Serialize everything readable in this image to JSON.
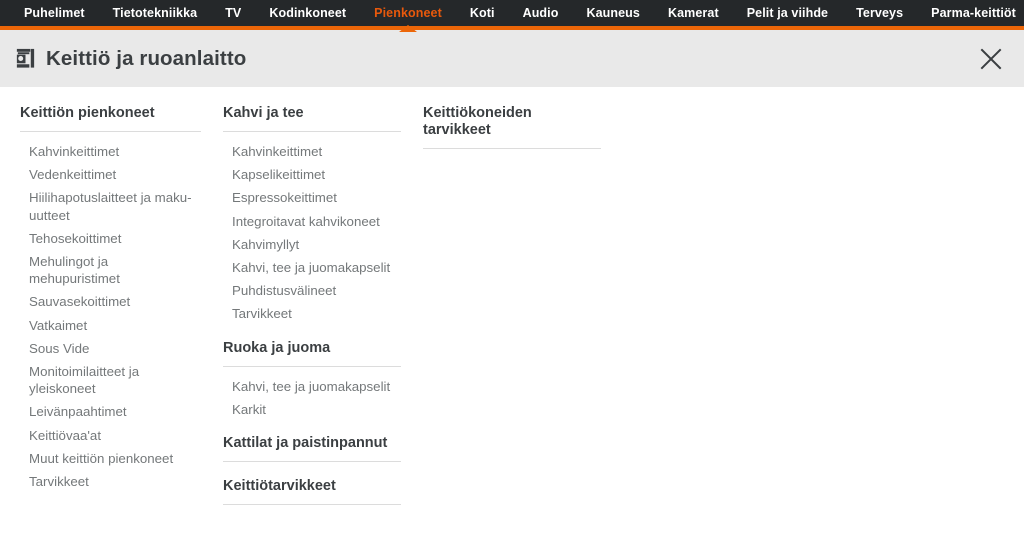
{
  "topnav": {
    "items": [
      {
        "label": "Puhelimet",
        "active": false
      },
      {
        "label": "Tietotekniikka",
        "active": false
      },
      {
        "label": "TV",
        "active": false
      },
      {
        "label": "Kodinkoneet",
        "active": false
      },
      {
        "label": "Pienkoneet",
        "active": true
      },
      {
        "label": "Koti",
        "active": false
      },
      {
        "label": "Audio",
        "active": false
      },
      {
        "label": "Kauneus",
        "active": false
      },
      {
        "label": "Kamerat",
        "active": false
      },
      {
        "label": "Pelit ja viihde",
        "active": false
      },
      {
        "label": "Terveys",
        "active": false
      },
      {
        "label": "Parma-keittiöt",
        "active": false
      }
    ],
    "active_color": "#e8590c",
    "bar_color": "#ec6608",
    "background": "#25282a"
  },
  "flyout": {
    "title": "Keittiö ja ruoanlaitto",
    "title_icon": "coffee-machine-icon",
    "close_icon": "close-icon",
    "background": "#e9e9e9",
    "columns": [
      {
        "groups": [
          {
            "heading": "Keittiön pienkoneet",
            "links": [
              "Kahvinkeittimet",
              "Vedenkeittimet",
              "Hiilihapotuslaitteet ja maku-uutteet",
              "Tehosekoittimet",
              "Mehulingot ja mehupuristimet",
              "Sauvasekoittimet",
              "Vatkaimet",
              "Sous Vide",
              "Monitoimilaitteet ja yleiskoneet",
              "Leivänpaahtimet",
              "Keittiövaa'at",
              "Muut keittiön pienkoneet",
              "Tarvikkeet"
            ]
          }
        ]
      },
      {
        "groups": [
          {
            "heading": "Kahvi ja tee",
            "links": [
              "Kahvinkeittimet",
              "Kapselikeittimet",
              "Espressokeittimet",
              "Integroitavat kahvikoneet",
              "Kahvimyllyt",
              "Kahvi, tee ja juomakapselit",
              "Puhdistusvälineet",
              "Tarvikkeet"
            ]
          },
          {
            "heading": "Ruoka ja juoma",
            "links": [
              "Kahvi, tee ja juomakapselit",
              "Karkit"
            ]
          },
          {
            "heading": "Kattilat ja paistinpannut",
            "links": []
          },
          {
            "heading": "Keittiötarvikkeet",
            "links": []
          }
        ]
      },
      {
        "groups": [
          {
            "heading": "Keittiökoneiden tarvikkeet",
            "links": []
          }
        ]
      }
    ]
  }
}
